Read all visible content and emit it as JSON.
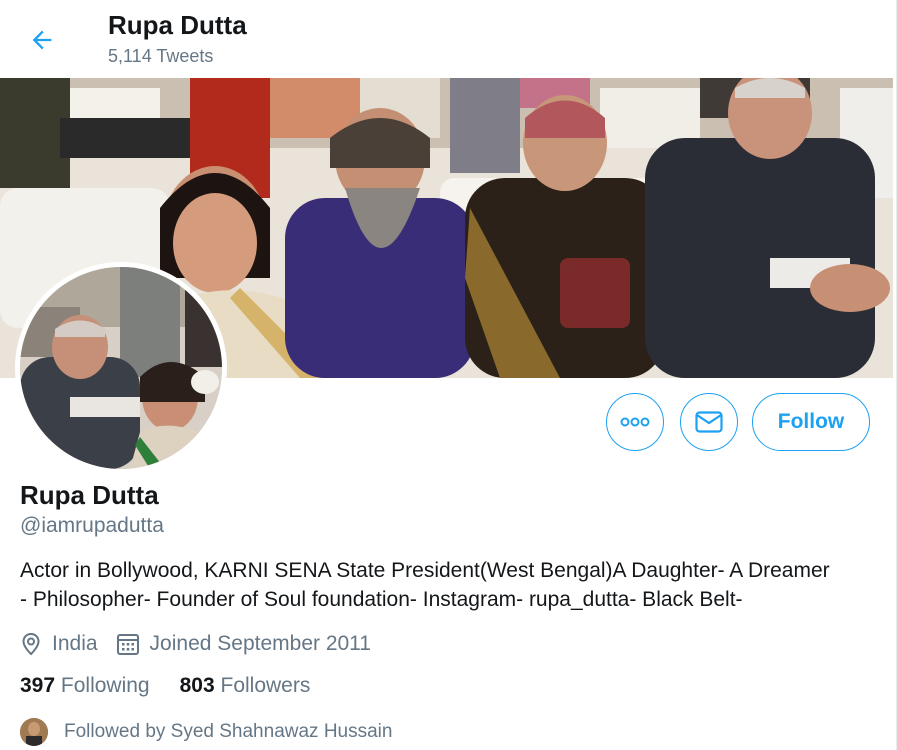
{
  "header": {
    "name": "Rupa Dutta",
    "tweet_count": "5,114 Tweets"
  },
  "profile": {
    "name": "Rupa Dutta",
    "handle": "@iamrupadutta",
    "bio_line1": "Actor in Bollywood, KARNI SENA State President(West Bengal)A Daughter- A Dreamer",
    "bio_line2": "- Philosopher- Founder of Soul foundation- Instagram- rupa_dutta- Black Belt-",
    "location": "India",
    "joined": "Joined September 2011"
  },
  "actions": {
    "follow_label": "Follow"
  },
  "stats": {
    "following_count": "397",
    "following_label": "Following",
    "followers_count": "803",
    "followers_label": "Followers"
  },
  "followed_by": "Followed by Syed Shahnawaz Hussain",
  "icons": {
    "back": "arrow-left-icon",
    "more": "more-dots-icon",
    "message": "envelope-icon",
    "location": "location-pin-icon",
    "calendar": "calendar-icon"
  },
  "colors": {
    "accent": "#1da1f2",
    "secondary_text": "#657786",
    "primary_text": "#14171a"
  }
}
